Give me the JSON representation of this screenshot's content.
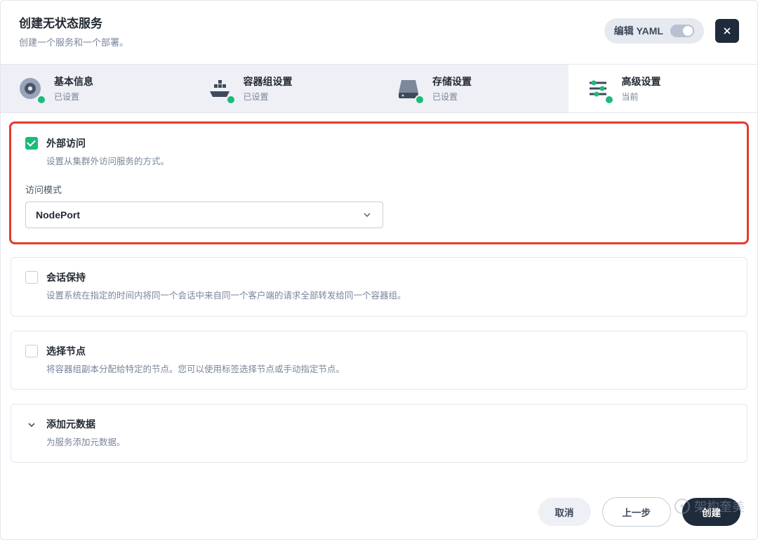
{
  "header": {
    "title": "创建无状态服务",
    "subtitle": "创建一个服务和一个部署。",
    "yaml_label": "编辑 YAML"
  },
  "steps": [
    {
      "title": "基本信息",
      "status": "已设置"
    },
    {
      "title": "容器组设置",
      "status": "已设置"
    },
    {
      "title": "存储设置",
      "status": "已设置"
    },
    {
      "title": "高级设置",
      "status": "当前"
    }
  ],
  "panels": {
    "external": {
      "title": "外部访问",
      "desc": "设置从集群外访问服务的方式。",
      "field_label": "访问模式",
      "select_value": "NodePort",
      "checked": true
    },
    "session": {
      "title": "会话保持",
      "desc": "设置系统在指定的时间内将同一个会话中来自同一个客户端的请求全部转发给同一个容器组。",
      "checked": false
    },
    "nodes": {
      "title": "选择节点",
      "desc": "将容器组副本分配给特定的节点。您可以使用标签选择节点或手动指定节点。",
      "checked": false
    },
    "metadata": {
      "title": "添加元数据",
      "desc": "为服务添加元数据。"
    }
  },
  "footer": {
    "cancel": "取消",
    "prev": "上一步",
    "create": "创建"
  },
  "watermark": "架构奎美"
}
